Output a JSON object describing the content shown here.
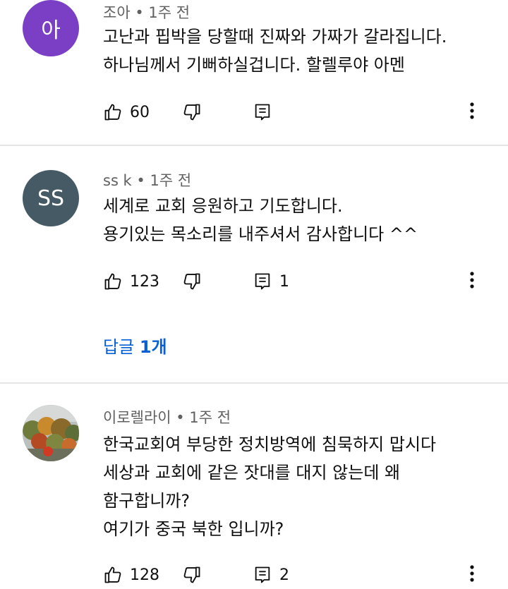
{
  "colors": {
    "accent_link": "#065fd4",
    "avatar_joa": "#7b3fc6",
    "avatar_ssk": "#455a64"
  },
  "comments": [
    {
      "avatar_text": "아",
      "author": "조아",
      "time": "1주 전",
      "lines": [
        "고난과 핍박을 당할때 진짜와 가짜가 갈라집니다.",
        "하나님께서 기뻐하실겁니다. 할렐루야 아멘"
      ],
      "likes": "60",
      "replies_count": ""
    },
    {
      "avatar_text": "SS",
      "author": "ss k",
      "time": "1주 전",
      "lines": [
        "세계로 교회 응원하고 기도합니다.",
        "용기있는 목소리를 내주셔서 감사합니다 ^^"
      ],
      "likes": "123",
      "replies_count": "1",
      "reply_link": {
        "label": "답글",
        "count": "1개"
      }
    },
    {
      "avatar_text": "",
      "avatar_icon": "autumn-landscape-photo",
      "author": "이로렐라이",
      "time": "1주 전",
      "lines": [
        "한국교회여 부당한 정치방역에 침묵하지 맙시다",
        "세상과 교회에 같은 잣대를 대지 않는데 왜",
        "함구합니까?",
        "여기가 중국 북한 입니까?"
      ],
      "likes": "128",
      "replies_count": "2"
    }
  ],
  "separator": "•"
}
